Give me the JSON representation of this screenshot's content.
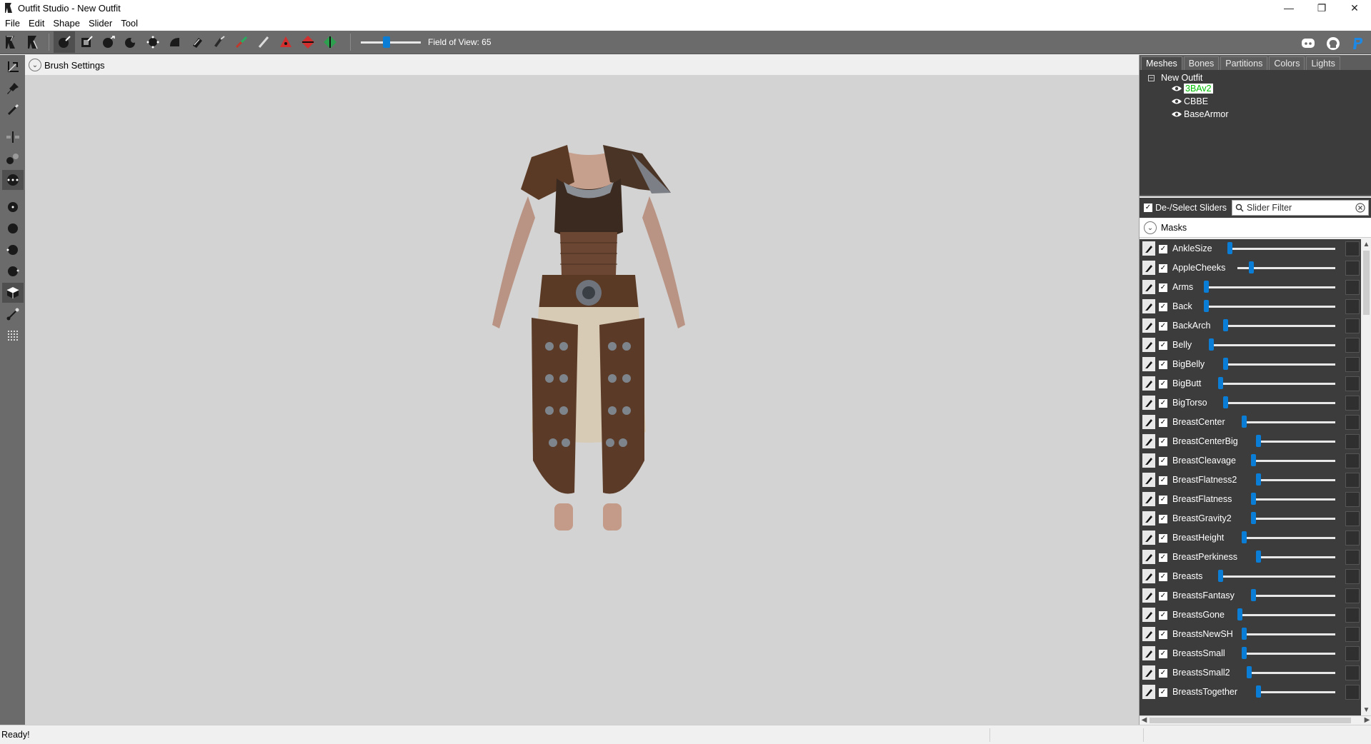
{
  "window": {
    "title": "Outfit Studio - New Outfit",
    "controls": {
      "minimize": "—",
      "restore": "❐",
      "close": "✕"
    }
  },
  "menu": [
    "File",
    "Edit",
    "Shape",
    "Slider",
    "Tool"
  ],
  "toolbar": {
    "buttons": [
      "select-tool-icon",
      "transform-tool-icon",
      "standard-brush-icon",
      "mask-brush-icon",
      "inflate-brush-icon",
      "deflate-brush-icon",
      "move-brush-icon",
      "smooth-brush-icon",
      "undiff-brush-icon",
      "eraser-icon",
      "weight-brush-icon",
      "color-brush-icon",
      "alpha-brush-icon",
      "collapse-vertex-icon",
      "flip-edge-icon",
      "split-edge-icon"
    ],
    "field_of_view_label": "Field of View: 65",
    "field_of_view_value": 65,
    "fov_slider_fraction": 0.42,
    "right_icons": [
      "discord-icon",
      "github-icon",
      "paypal-icon"
    ]
  },
  "left_tools": [
    "transform-icon",
    "pin-icon",
    "pencil-icon",
    "x-mirror-icon",
    "connected-icon",
    "global-brush-icon",
    "vertex-point-icon",
    "sphere-icon",
    "sphere-cut-icon",
    "sphere-half-icon",
    "cube-icon",
    "bone-icon",
    "grid-icon"
  ],
  "viewport": {
    "brush_settings_label": "Brush Settings",
    "background_color": "#d3d3d3"
  },
  "right_panel": {
    "tabs": [
      "Meshes",
      "Bones",
      "Partitions",
      "Colors",
      "Lights"
    ],
    "selected_tab": "Meshes",
    "tree": {
      "root": "New Outfit",
      "expander": "−",
      "children": [
        {
          "name": "3BAv2",
          "selected": true
        },
        {
          "name": "CBBE",
          "selected": false
        },
        {
          "name": "BaseArmor",
          "selected": false
        }
      ]
    },
    "deselect_label": "De-/Select Sliders",
    "slider_filter_placeholder": "Slider Filter",
    "masks_label": "Masks",
    "sliders": [
      {
        "name": "AnkleSize",
        "value": 0.0
      },
      {
        "name": "AppleCheeks",
        "value": 0.12
      },
      {
        "name": "Arms",
        "value": 0.0
      },
      {
        "name": "Back",
        "value": 0.0
      },
      {
        "name": "BackArch",
        "value": 0.0
      },
      {
        "name": "Belly",
        "value": 0.0
      },
      {
        "name": "BigBelly",
        "value": 0.0
      },
      {
        "name": "BigButt",
        "value": 0.0
      },
      {
        "name": "BigTorso",
        "value": 0.0
      },
      {
        "name": "BreastCenter",
        "value": 0.0
      },
      {
        "name": "BreastCenterBig",
        "value": 0.0
      },
      {
        "name": "BreastCleavage",
        "value": 0.0
      },
      {
        "name": "BreastFlatness2",
        "value": 0.0
      },
      {
        "name": "BreastFlatness",
        "value": 0.0
      },
      {
        "name": "BreastGravity2",
        "value": 0.0
      },
      {
        "name": "BreastHeight",
        "value": 0.0
      },
      {
        "name": "BreastPerkiness",
        "value": 0.0
      },
      {
        "name": "Breasts",
        "value": 0.0
      },
      {
        "name": "BreastsFantasy",
        "value": 0.0
      },
      {
        "name": "BreastsGone",
        "value": 0.0
      },
      {
        "name": "BreastsNewSH",
        "value": 0.0
      },
      {
        "name": "BreastsSmall",
        "value": 0.0
      },
      {
        "name": "BreastsSmall2",
        "value": 0.0
      },
      {
        "name": "BreastsTogether",
        "value": 0.0
      }
    ]
  },
  "status": {
    "text": "Ready!"
  },
  "colors": {
    "accent": "#0a7ed6",
    "dark_panel": "#3c3c3c",
    "toolbar": "#6b6b6b",
    "selected_mesh_text": "#00c000"
  }
}
